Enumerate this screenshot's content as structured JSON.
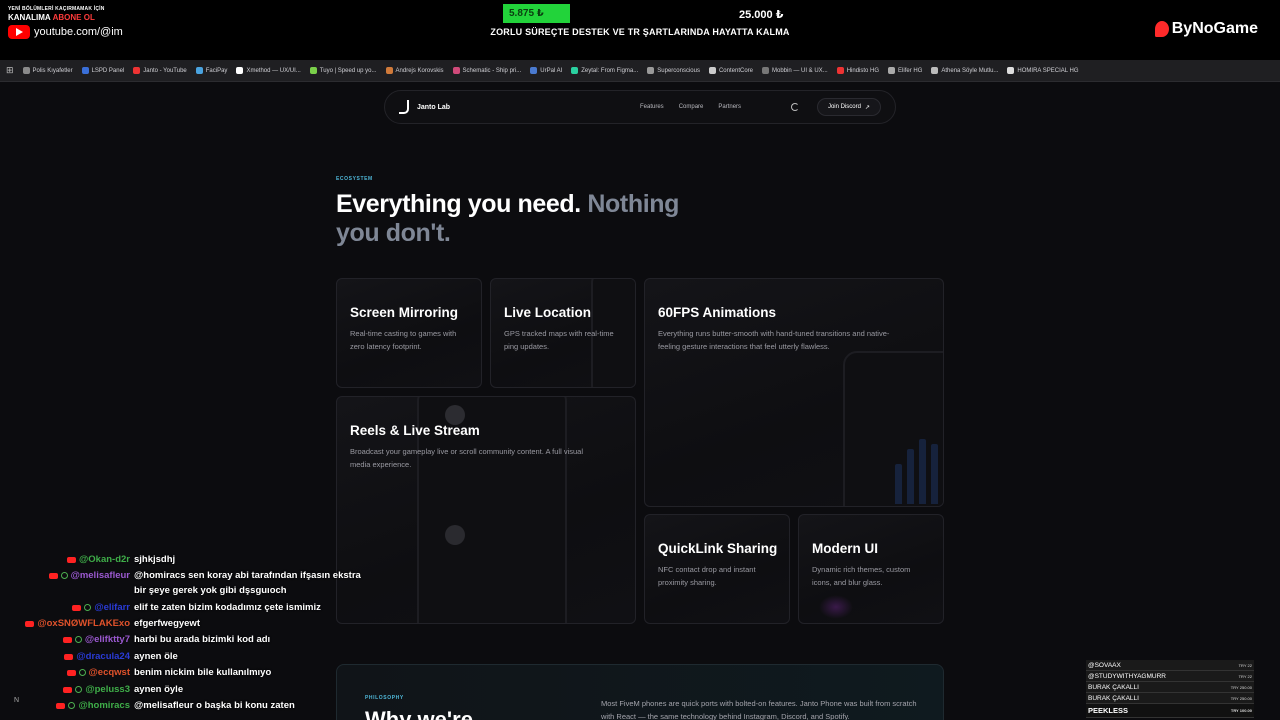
{
  "stream": {
    "promo_small": "YENİ BÖLÜMLERİ KAÇIRMAMAK İÇİN",
    "promo_abone_prefix": "KANALIMA",
    "promo_abone_word": "ABONE OL",
    "youtube_handle": "youtube.com/@im",
    "goal_current": "5.875 ₺",
    "goal_target": "25.000 ₺",
    "goal_text": "ZORLU SÜREÇTE DESTEK VE TR ŞARTLARINDA HAYATTA KALMA",
    "brand": "ByNoGame",
    "goal_progress": 0.235,
    "accent_green": "#22d33a"
  },
  "bookmarks": [
    "Polis Kıyafetler",
    "LSPD Panel",
    "Janto - YouTube",
    "FaciPay",
    "Xmethod — UX/UI...",
    "Tuyo | Speed up yo...",
    "Andrejs Korovskis",
    "Schematic - Ship pri...",
    "UrPal AI",
    "Zeytal: From Figma...",
    "Superconscious",
    "ContentCore",
    "Mobbin — UI & UX...",
    "Hindisto HG",
    "Elifer HG",
    "Athena Söyle Mutlu...",
    "HOMIRA SPECIAL HG"
  ],
  "nav": {
    "brand": "Janto Lab",
    "links": [
      "Features",
      "Compare",
      "Partners"
    ],
    "cta": "Join Discord",
    "cta_arrow": "↗"
  },
  "hero": {
    "eyebrow": "ECOSYSTEM",
    "title_main": "Everything you need.",
    "title_dim": "Nothing you don't."
  },
  "cards": {
    "mirror": {
      "title": "Screen Mirroring",
      "desc": "Real-time casting to games with zero latency footprint."
    },
    "location": {
      "title": "Live Location",
      "desc": "GPS tracked maps with real-time ping updates."
    },
    "fps": {
      "title": "60FPS Animations",
      "desc": "Everything runs butter-smooth with hand-tuned transitions and native-feeling gesture interactions that feel utterly flawless."
    },
    "reels": {
      "title": "Reels & Live Stream",
      "desc": "Broadcast your gameplay live or scroll community content. A full visual media experience."
    },
    "quicklink": {
      "title": "QuickLink Sharing",
      "desc": "NFC contact drop and instant proximity sharing."
    },
    "modern": {
      "title": "Modern UI",
      "desc": "Dynamic rich themes, custom icons, and blur glass."
    }
  },
  "philosophy": {
    "eyebrow": "PHILOSOPHY",
    "title": "Why we're",
    "text": "Most FiveM phones are quick ports with bolted-on features. Janto Phone was built from scratch with React — the same technology behind Instagram, Discord, and Spotify."
  },
  "chat": [
    {
      "user": "@Okan-d2r",
      "color": "#3fae49",
      "text": "sjhkjsdhj",
      "badges": 1
    },
    {
      "user": "@melisafleur",
      "color": "#9b59d0",
      "text": "@homiracs sen koray abi tarafından ifşasın ekstra bir şeye gerek yok gibi dşsguıoch",
      "badges": 2
    },
    {
      "user": "@elifarr",
      "color": "#2a3bd6",
      "text": "elif te zaten bizim kodadımız çete ismimiz",
      "badges": 2
    },
    {
      "user": "@oxSNØWFLAKExo",
      "color": "#e0522b",
      "text": "efgerfwegyewt",
      "badges": 1
    },
    {
      "user": "@elifktty7",
      "color": "#9b59d0",
      "text": "harbi bu arada bizimki kod adı",
      "badges": 2
    },
    {
      "user": "@dracula24",
      "color": "#2a3bd6",
      "text": "aynen öle",
      "badges": 1
    },
    {
      "user": "@ecqwst",
      "color": "#e0522b",
      "text": "benim nickim bile kullanılmıyo",
      "badges": 2
    },
    {
      "user": "@peluss3",
      "color": "#3fae49",
      "text": "aynen öyle",
      "badges": 2
    },
    {
      "user": "@homiracs",
      "color": "#3fae49",
      "text": "@melisafleur o başka bi konu zaten",
      "badges": 2
    }
  ],
  "donors": [
    {
      "name": "@SOVAAX",
      "amount": "TRY 22"
    },
    {
      "name": "@STUDYWITHYAGMURR",
      "amount": "TRY 22"
    },
    {
      "name": "BURAK ÇAKALLI",
      "amount": "TRY 250.00"
    },
    {
      "name": "BURAK ÇAKALLI",
      "amount": "TRY 250.00"
    },
    {
      "name": "PEEKLESS",
      "amount": "TRY 100.00"
    }
  ],
  "corner_badge": "N"
}
